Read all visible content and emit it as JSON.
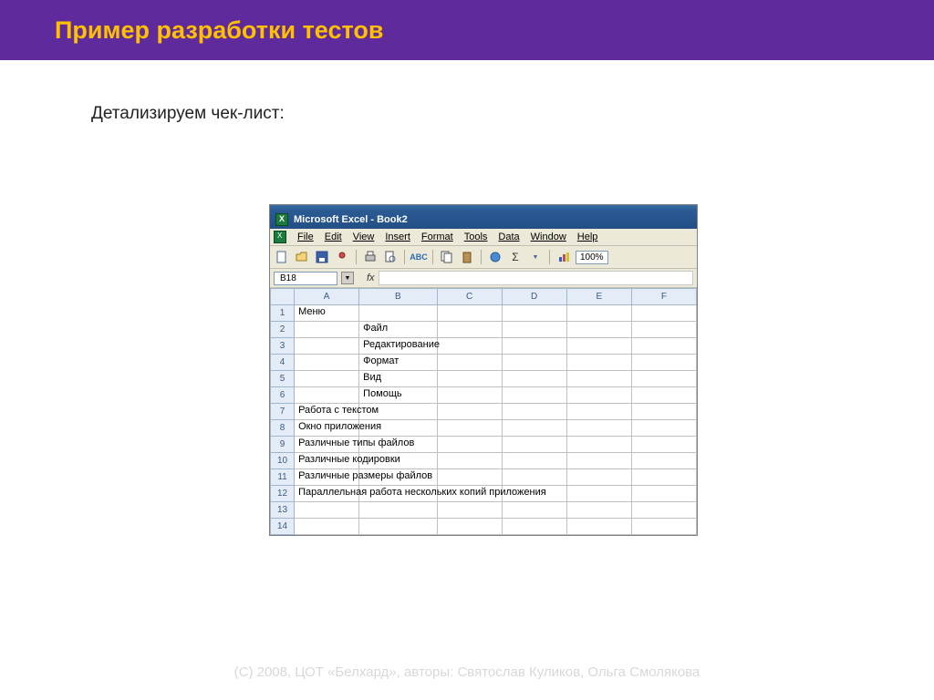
{
  "slide": {
    "title": "Пример разработки тестов",
    "subtitle": "Детализируем чек-лист:",
    "footer": "(С) 2008, ЦОТ «Белхард», авторы: Святослав Куликов, Ольга Смолякова"
  },
  "excel": {
    "window_title": "Microsoft Excel - Book2",
    "menu": [
      "File",
      "Edit",
      "View",
      "Insert",
      "Format",
      "Tools",
      "Data",
      "Window",
      "Help"
    ],
    "zoom": "100%",
    "cell_ref": "B18",
    "fx_label": "fx",
    "columns": [
      "A",
      "B",
      "C",
      "D",
      "E",
      "F"
    ],
    "rows": [
      {
        "n": "1",
        "A": "Меню",
        "B": ""
      },
      {
        "n": "2",
        "A": "",
        "B": "Файл"
      },
      {
        "n": "3",
        "A": "",
        "B": "Редактирование"
      },
      {
        "n": "4",
        "A": "",
        "B": "Формат"
      },
      {
        "n": "5",
        "A": "",
        "B": "Вид"
      },
      {
        "n": "6",
        "A": "",
        "B": "Помощь"
      },
      {
        "n": "7",
        "A": "Работа с текстом",
        "B": ""
      },
      {
        "n": "8",
        "A": "Окно приложения",
        "B": ""
      },
      {
        "n": "9",
        "A": "Различные типы файлов",
        "B": ""
      },
      {
        "n": "10",
        "A": "Различные кодировки",
        "B": ""
      },
      {
        "n": "11",
        "A": "Различные размеры файлов",
        "B": ""
      },
      {
        "n": "12",
        "A": "Параллельная работа нескольких копий приложения",
        "B": ""
      },
      {
        "n": "13",
        "A": "",
        "B": ""
      },
      {
        "n": "14",
        "A": "",
        "B": ""
      }
    ]
  }
}
